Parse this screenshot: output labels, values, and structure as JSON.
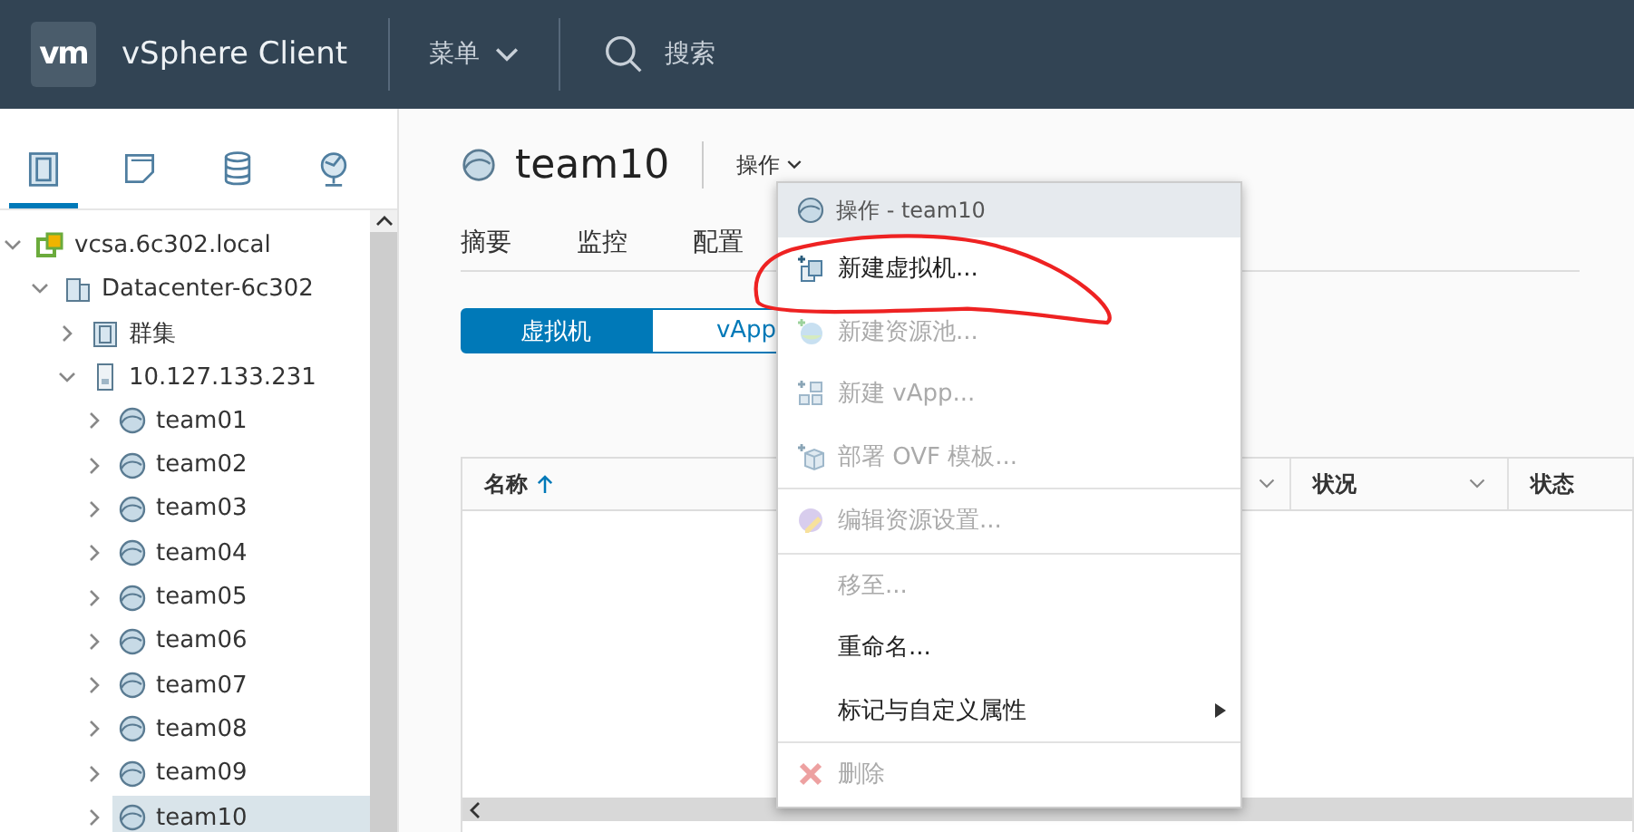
{
  "header": {
    "logo": "vm",
    "product": "vSphere Client",
    "menu": "菜单",
    "search": "搜索"
  },
  "sidebar": {
    "view_tabs": [
      {
        "kind": "hosts",
        "selected": true
      },
      {
        "kind": "vms",
        "selected": false
      },
      {
        "kind": "storage",
        "selected": false
      },
      {
        "kind": "network",
        "selected": false
      }
    ],
    "tree": [
      {
        "label": "vcsa.6c302.local",
        "kind": "vcenter",
        "expanded": true,
        "selected": false,
        "children": [
          {
            "label": "Datacenter-6c302",
            "kind": "datacenter",
            "expanded": true,
            "selected": false,
            "children": [
              {
                "label": "群集",
                "kind": "cluster",
                "expanded": false,
                "selected": false
              },
              {
                "label": "10.127.133.231",
                "kind": "host",
                "expanded": true,
                "selected": false,
                "children": [
                  {
                    "label": "team01",
                    "kind": "vm",
                    "expanded": false,
                    "selected": false
                  },
                  {
                    "label": "team02",
                    "kind": "vm",
                    "expanded": false,
                    "selected": false
                  },
                  {
                    "label": "team03",
                    "kind": "vm",
                    "expanded": false,
                    "selected": false
                  },
                  {
                    "label": "team04",
                    "kind": "vm",
                    "expanded": false,
                    "selected": false
                  },
                  {
                    "label": "team05",
                    "kind": "vm",
                    "expanded": false,
                    "selected": false
                  },
                  {
                    "label": "team06",
                    "kind": "vm",
                    "expanded": false,
                    "selected": false
                  },
                  {
                    "label": "team07",
                    "kind": "vm",
                    "expanded": false,
                    "selected": false
                  },
                  {
                    "label": "team08",
                    "kind": "vm",
                    "expanded": false,
                    "selected": false
                  },
                  {
                    "label": "team09",
                    "kind": "vm",
                    "expanded": false,
                    "selected": false
                  },
                  {
                    "label": "team10",
                    "kind": "vm",
                    "expanded": false,
                    "selected": true
                  }
                ]
              }
            ]
          }
        ]
      }
    ]
  },
  "main": {
    "title": "team10",
    "actions": "操作",
    "tabs": [
      "摘要",
      "监控",
      "配置"
    ],
    "toggle": [
      {
        "label": "虚拟机",
        "selected": true
      },
      {
        "label": "vApp",
        "selected": false
      }
    ],
    "table": {
      "columns": [
        {
          "label": "名称",
          "sorted": true
        },
        {
          "label": "状况",
          "sorted": false
        },
        {
          "label": "状态",
          "sorted": false
        }
      ]
    }
  },
  "menu": {
    "title": "操作 - team10",
    "items": [
      {
        "kind": "new-vm",
        "label": "新建虚拟机...",
        "disabled": false
      },
      {
        "kind": "resource-pool",
        "label": "新建资源池...",
        "disabled": true
      },
      {
        "kind": "vapp",
        "label": "新建 vApp...",
        "disabled": true
      },
      {
        "kind": "ovf",
        "label": "部署 OVF 模板...",
        "disabled": true
      },
      {
        "kind": "divider"
      },
      {
        "kind": "edit-resource",
        "label": "编辑资源设置...",
        "disabled": true
      },
      {
        "kind": "divider"
      },
      {
        "kind": "plain",
        "label": "移至...",
        "disabled": true
      },
      {
        "kind": "plain",
        "label": "重命名...",
        "disabled": false
      },
      {
        "kind": "submenu",
        "label": "标记与自定义属性",
        "disabled": false
      },
      {
        "kind": "divider"
      },
      {
        "kind": "delete",
        "label": "删除",
        "disabled": true
      }
    ]
  }
}
